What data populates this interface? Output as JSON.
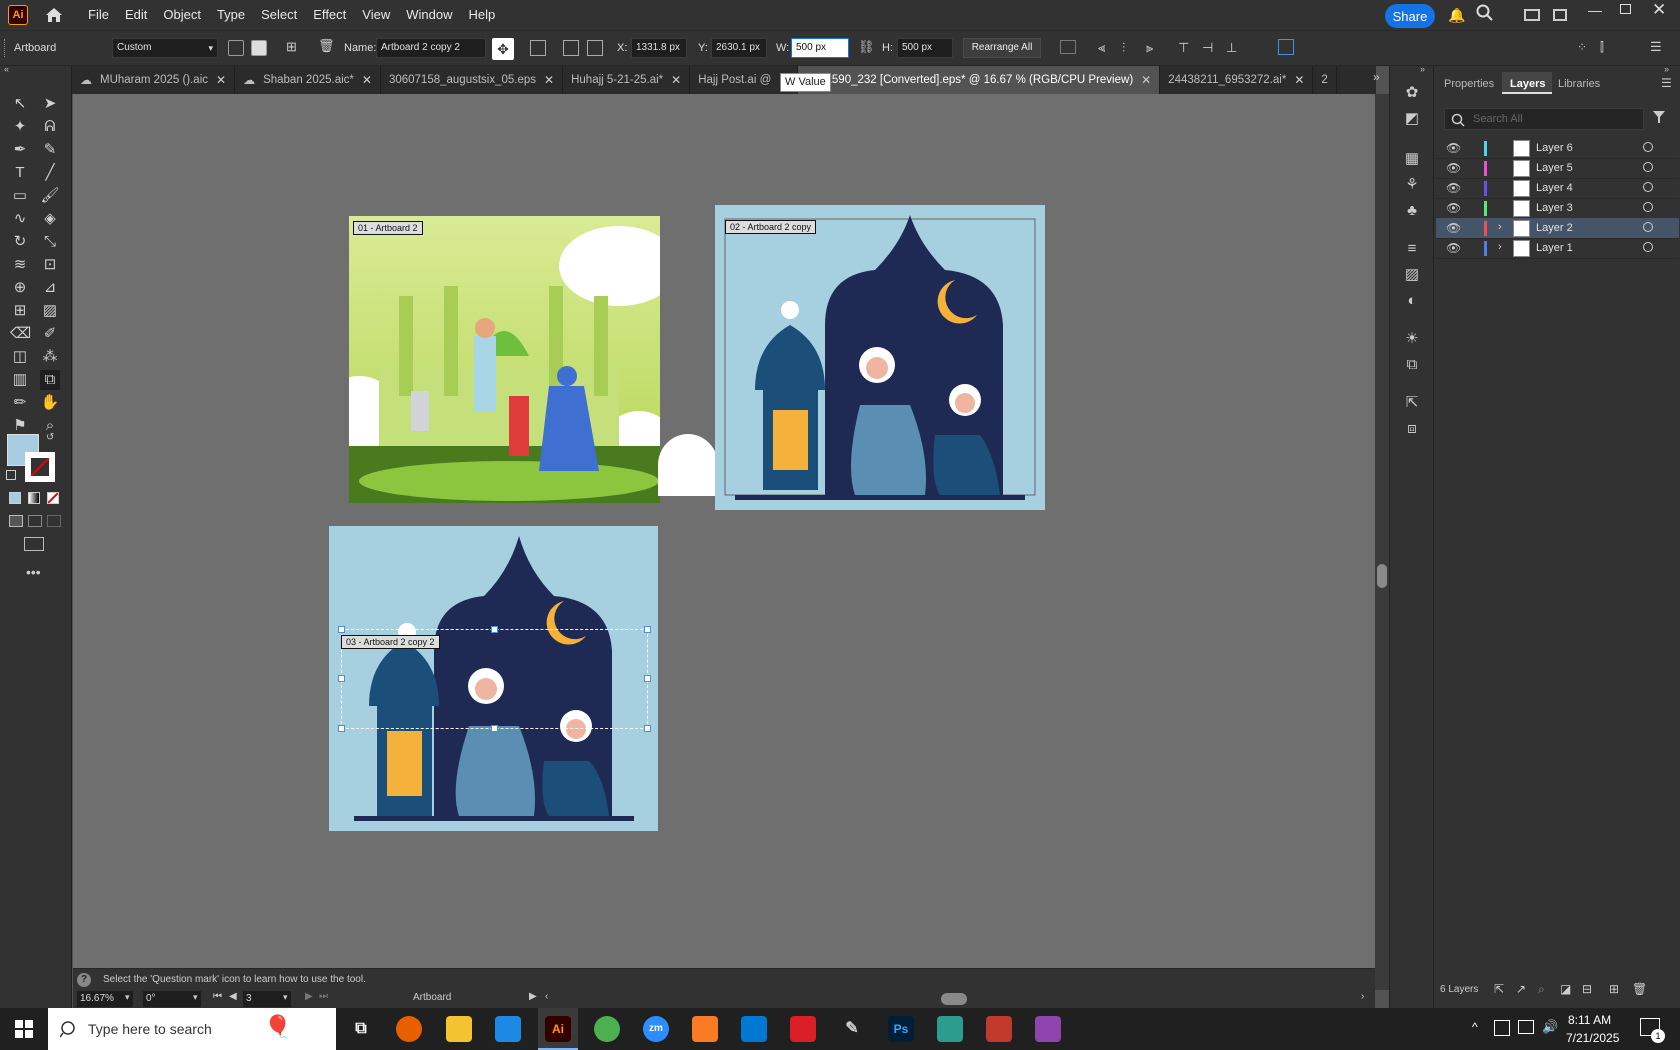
{
  "app": {
    "logo": "Ai"
  },
  "menu": [
    "File",
    "Edit",
    "Object",
    "Type",
    "Select",
    "Effect",
    "View",
    "Window",
    "Help"
  ],
  "share_label": "Share",
  "control": {
    "tool_label": "Artboard",
    "preset": "Custom",
    "name_label": "Name:",
    "name_value": "Artboard 2 copy 2",
    "x_label": "X:",
    "x_value": "1331.8 px",
    "y_label": "Y:",
    "y_value": "2630.1 px",
    "w_label": "W:",
    "w_value": "500 px",
    "h_label": "H:",
    "h_value": "500 px",
    "rearrange": "Rearrange All"
  },
  "tooltip": "W Value",
  "tabs": [
    {
      "label": "MUharam 2025 ().aic",
      "cloud": true
    },
    {
      "label": "Shaban 2025.aic*",
      "cloud": true
    },
    {
      "label": "30607158_augustsix_05.eps",
      "cloud": false
    },
    {
      "label": "Huhajj 5-21-25.ai*",
      "cloud": false
    },
    {
      "label": "Hajj Post.ai @",
      "cloud": false
    },
    {
      "label": "8292590_232 [Converted].eps* @ 16.67 % (RGB/CPU Preview)",
      "cloud": false,
      "active": true
    },
    {
      "label": "24438211_6953272.ai*",
      "cloud": false
    },
    {
      "label": "2",
      "cloud": false
    }
  ],
  "artboards": [
    {
      "label": "01 - Artboard 2"
    },
    {
      "label": "02 - Artboard 2 copy"
    },
    {
      "label": "03 - Artboard 2 copy 2"
    }
  ],
  "panel": {
    "tabs": [
      "Properties",
      "Layers",
      "Libraries"
    ],
    "search_placeholder": "Search All",
    "layers": [
      {
        "name": "Layer 6",
        "color": "#4fd6ef",
        "selected": false
      },
      {
        "name": "Layer 5",
        "color": "#ef4fd8",
        "selected": false
      },
      {
        "name": "Layer 4",
        "color": "#6a4fef",
        "selected": false
      },
      {
        "name": "Layer 3",
        "color": "#4fef6a",
        "selected": false
      },
      {
        "name": "Layer 2",
        "color": "#ef4f4f",
        "selected": true
      },
      {
        "name": "Layer 1",
        "color": "#4f7cef",
        "selected": false
      }
    ],
    "footer_count": "6 Layers"
  },
  "status": {
    "help": "Select the 'Question mark' icon to learn how to use the tool.",
    "zoom": "16.67%",
    "rotation": "0°",
    "artboard_num": "3",
    "tool": "Artboard"
  },
  "taskbar": {
    "search_placeholder": "Type here to search",
    "time": "8:11 AM",
    "date": "7/21/2025",
    "notif": "1"
  }
}
